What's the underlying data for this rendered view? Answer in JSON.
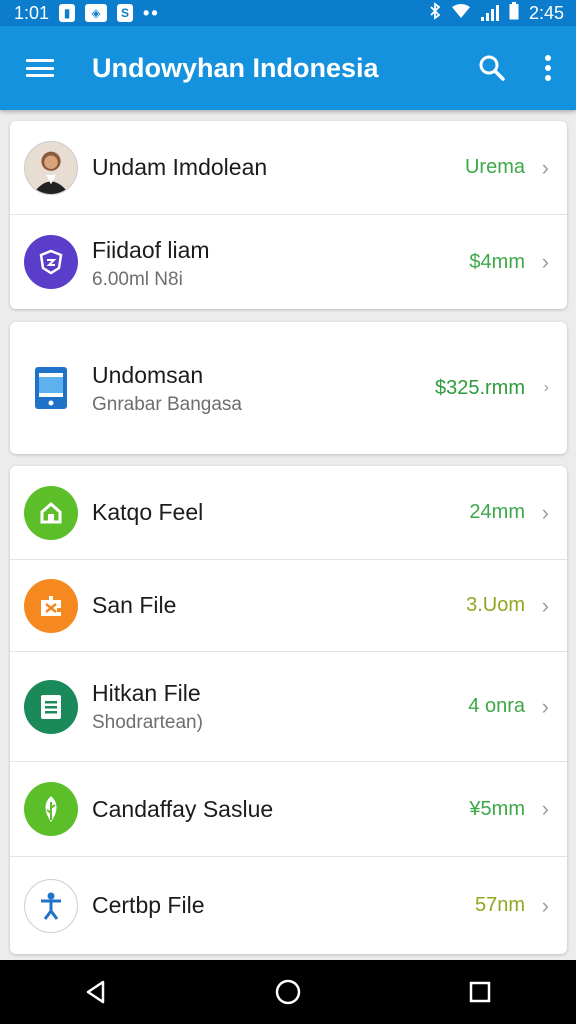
{
  "status_bar": {
    "time": "1:01",
    "right_time": "2:45",
    "dots": "••"
  },
  "app_bar": {
    "title": "Undowyhan Indonesia"
  },
  "cards": [
    {
      "items": [
        {
          "title": "Undam Imdolean",
          "subtitle": "",
          "value": "Urema",
          "icon": "person-avatar",
          "icon_color": "#6b4a2e"
        },
        {
          "title": "Fiidaof liam",
          "subtitle": "6.00ml N8i",
          "value": "$4mm",
          "icon": "shield-icon",
          "icon_color": "#5a3dc8"
        }
      ]
    },
    {
      "items": [
        {
          "title": "Undomsan",
          "subtitle": "Gnrabar Bangasa",
          "value": "$325.rmm",
          "icon": "tablet-icon",
          "icon_color": "#1e73c9"
        }
      ]
    },
    {
      "items": [
        {
          "title": "Katqo Feel",
          "subtitle": "",
          "value": "24mm",
          "icon": "home-icon",
          "icon_color": "#5cbf2a"
        },
        {
          "title": "San File",
          "subtitle": "",
          "value": "3.Uom",
          "icon": "puzzle-icon",
          "icon_color": "#f5891f"
        },
        {
          "title": "Hitkan File",
          "subtitle": "Shodrartean)",
          "value": "4 onra",
          "icon": "document-icon",
          "icon_color": "#1b8a5a"
        },
        {
          "title": "Candaffay Saslue",
          "subtitle": "",
          "value": "¥5mm",
          "icon": "leaf-icon",
          "icon_color": "#5cbf2a"
        },
        {
          "title": "Certbp File",
          "subtitle": "",
          "value": "57nm",
          "icon": "figure-icon",
          "icon_color": "#1e73c9"
        }
      ]
    }
  ]
}
